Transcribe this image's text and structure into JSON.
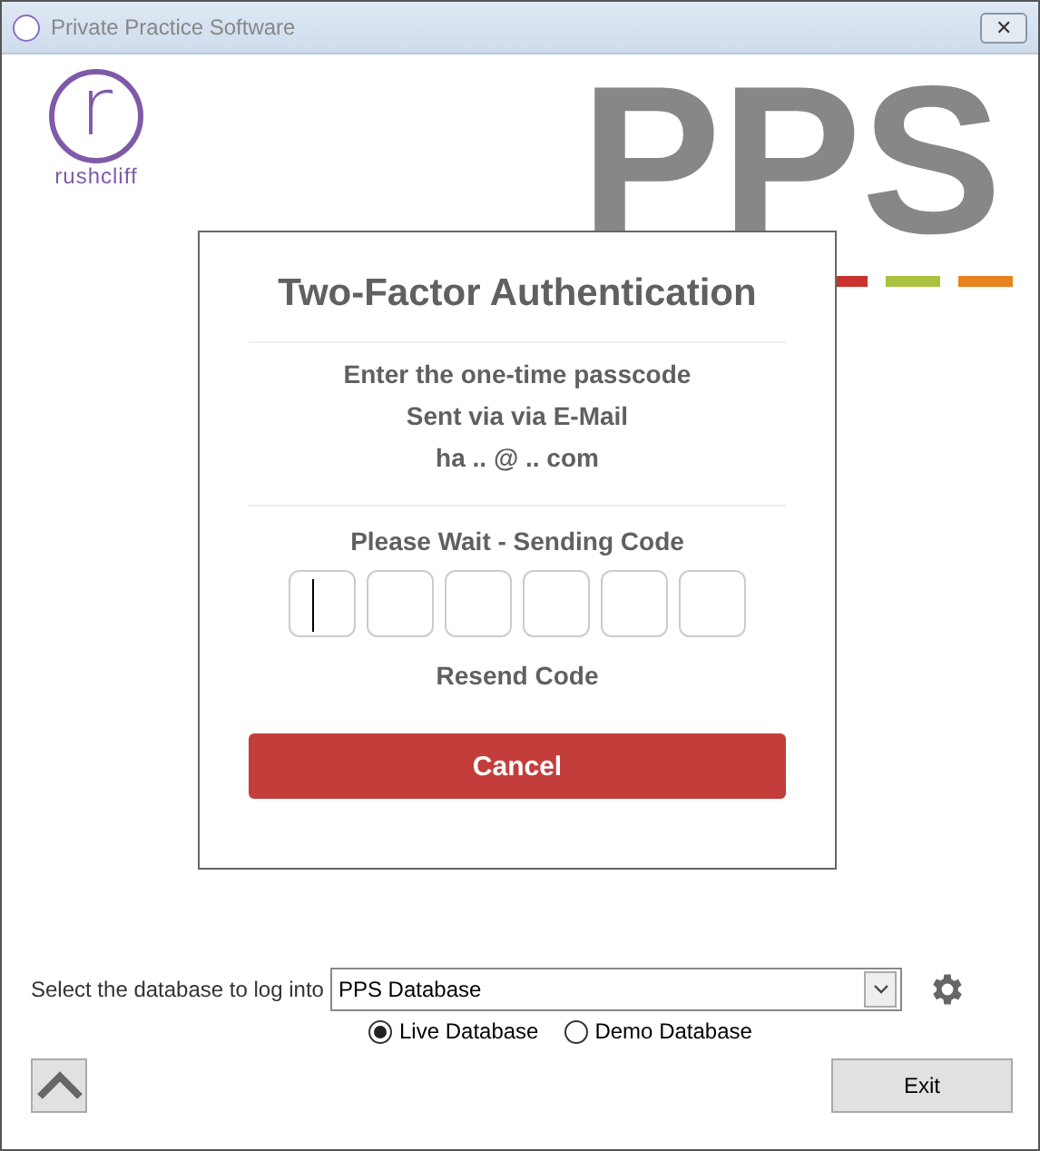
{
  "window": {
    "title": "Private Practice Software",
    "close_glyph": "✕"
  },
  "logo": {
    "letter": "r",
    "name": "rushcliff"
  },
  "brand": {
    "text": "PPS",
    "stripes": [
      {
        "color": "#c8332e"
      },
      {
        "color": "#a9c23f"
      },
      {
        "color": "#e8821e"
      }
    ]
  },
  "dialog": {
    "title": "Two-Factor Authentication",
    "lines": [
      "Enter the one-time passcode",
      "Sent via via E-Mail",
      "ha .. @ .. com"
    ],
    "status": "Please Wait - Sending Code",
    "code_boxes": [
      {
        "focused": true
      },
      {
        "focused": false
      },
      {
        "focused": false
      },
      {
        "focused": false
      },
      {
        "focused": false
      },
      {
        "focused": false
      }
    ],
    "resend": "Resend Code",
    "cancel": "Cancel"
  },
  "database": {
    "label": "Select the database to log into",
    "value": "PPS Database",
    "options": [
      {
        "label": "Live Database",
        "selected": true
      },
      {
        "label": "Demo Database",
        "selected": false
      }
    ]
  },
  "exit": "Exit"
}
